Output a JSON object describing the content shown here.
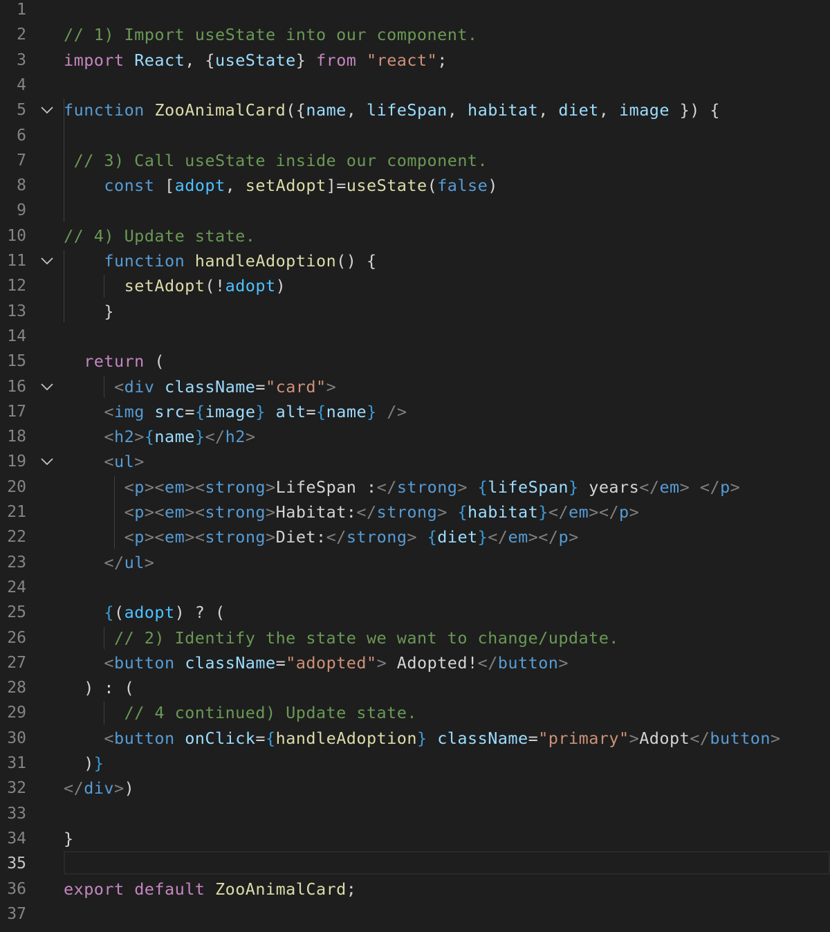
{
  "editor": {
    "current_line": 35,
    "fold_lines": [
      5,
      11,
      16,
      19
    ],
    "colors": {
      "background": "#1e1e1e",
      "comment": "#6a9955",
      "keyword": "#c586c0",
      "declaration": "#569cd6",
      "function": "#dcdcaa",
      "variable": "#9cdcfe",
      "constant": "#4fc1ff",
      "string": "#ce9178",
      "text": "#d4d4d4",
      "line_number": "#858585"
    },
    "lines": [
      {
        "n": "1",
        "indent": 0,
        "tokens": []
      },
      {
        "n": "2",
        "indent": 0,
        "tokens": [
          {
            "t": "// 1) Import useState into our component.",
            "c": "comment"
          }
        ]
      },
      {
        "n": "3",
        "indent": 0,
        "tokens": [
          {
            "t": "import",
            "c": "kw"
          },
          {
            "t": " ",
            "c": "text"
          },
          {
            "t": "React",
            "c": "var"
          },
          {
            "t": ", {",
            "c": "text"
          },
          {
            "t": "useState",
            "c": "var"
          },
          {
            "t": "} ",
            "c": "text"
          },
          {
            "t": "from",
            "c": "kw"
          },
          {
            "t": " ",
            "c": "text"
          },
          {
            "t": "\"react\"",
            "c": "str"
          },
          {
            "t": ";",
            "c": "text"
          }
        ]
      },
      {
        "n": "4",
        "indent": 0,
        "tokens": []
      },
      {
        "n": "5",
        "indent": 0,
        "tokens": [
          {
            "t": "function",
            "c": "decl"
          },
          {
            "t": " ",
            "c": "text"
          },
          {
            "t": "ZooAnimalCard",
            "c": "fn"
          },
          {
            "t": "({",
            "c": "text"
          },
          {
            "t": "name",
            "c": "var"
          },
          {
            "t": ", ",
            "c": "text"
          },
          {
            "t": "lifeSpan",
            "c": "var"
          },
          {
            "t": ", ",
            "c": "text"
          },
          {
            "t": "habitat",
            "c": "var"
          },
          {
            "t": ", ",
            "c": "text"
          },
          {
            "t": "diet",
            "c": "var"
          },
          {
            "t": ", ",
            "c": "text"
          },
          {
            "t": "image",
            "c": "var"
          },
          {
            "t": " }) {",
            "c": "text"
          }
        ]
      },
      {
        "n": "6",
        "indent": 0,
        "tokens": []
      },
      {
        "n": "7",
        "indent": 1,
        "tokens": [
          {
            "t": "// 3) Call useState inside our component.",
            "c": "comment"
          }
        ]
      },
      {
        "n": "8",
        "indent": 4,
        "tokens": [
          {
            "t": "const",
            "c": "decl"
          },
          {
            "t": " [",
            "c": "text"
          },
          {
            "t": "adopt",
            "c": "const"
          },
          {
            "t": ", ",
            "c": "text"
          },
          {
            "t": "setAdopt",
            "c": "fn"
          },
          {
            "t": "]=",
            "c": "text"
          },
          {
            "t": "useState",
            "c": "fn"
          },
          {
            "t": "(",
            "c": "text"
          },
          {
            "t": "false",
            "c": "decl"
          },
          {
            "t": ")",
            "c": "text"
          }
        ]
      },
      {
        "n": "9",
        "indent": 0,
        "tokens": []
      },
      {
        "n": "10",
        "indent": 0,
        "tokens": [
          {
            "t": "// 4) Update state.",
            "c": "comment"
          }
        ]
      },
      {
        "n": "11",
        "indent": 4,
        "tokens": [
          {
            "t": "function",
            "c": "decl"
          },
          {
            "t": " ",
            "c": "text"
          },
          {
            "t": "handleAdoption",
            "c": "fn"
          },
          {
            "t": "() {",
            "c": "text"
          }
        ]
      },
      {
        "n": "12",
        "indent": 6,
        "tokens": [
          {
            "t": "setAdopt",
            "c": "fn"
          },
          {
            "t": "(!",
            "c": "text"
          },
          {
            "t": "adopt",
            "c": "const"
          },
          {
            "t": ")",
            "c": "text"
          }
        ]
      },
      {
        "n": "13",
        "indent": 4,
        "tokens": [
          {
            "t": "}",
            "c": "text"
          }
        ]
      },
      {
        "n": "14",
        "indent": 0,
        "tokens": []
      },
      {
        "n": "15",
        "indent": 2,
        "tokens": [
          {
            "t": "return",
            "c": "kw"
          },
          {
            "t": " (",
            "c": "text"
          }
        ]
      },
      {
        "n": "16",
        "indent": 5,
        "tokens": [
          {
            "t": "<",
            "c": "bracket"
          },
          {
            "t": "div",
            "c": "tag"
          },
          {
            "t": " ",
            "c": "text"
          },
          {
            "t": "className",
            "c": "var"
          },
          {
            "t": "=",
            "c": "text"
          },
          {
            "t": "\"card\"",
            "c": "str"
          },
          {
            "t": ">",
            "c": "bracket"
          }
        ]
      },
      {
        "n": "17",
        "indent": 4,
        "tokens": [
          {
            "t": "<",
            "c": "bracket"
          },
          {
            "t": "img",
            "c": "tag"
          },
          {
            "t": " ",
            "c": "text"
          },
          {
            "t": "src",
            "c": "var"
          },
          {
            "t": "=",
            "c": "text"
          },
          {
            "t": "{",
            "c": "brace"
          },
          {
            "t": "image",
            "c": "var"
          },
          {
            "t": "}",
            "c": "brace"
          },
          {
            "t": " ",
            "c": "text"
          },
          {
            "t": "alt",
            "c": "var"
          },
          {
            "t": "=",
            "c": "text"
          },
          {
            "t": "{",
            "c": "brace"
          },
          {
            "t": "name",
            "c": "var"
          },
          {
            "t": "}",
            "c": "brace"
          },
          {
            "t": " />",
            "c": "bracket"
          }
        ]
      },
      {
        "n": "18",
        "indent": 4,
        "tokens": [
          {
            "t": "<",
            "c": "bracket"
          },
          {
            "t": "h2",
            "c": "tag"
          },
          {
            "t": ">",
            "c": "bracket"
          },
          {
            "t": "{",
            "c": "brace"
          },
          {
            "t": "name",
            "c": "var"
          },
          {
            "t": "}",
            "c": "brace"
          },
          {
            "t": "</",
            "c": "bracket"
          },
          {
            "t": "h2",
            "c": "tag"
          },
          {
            "t": ">",
            "c": "bracket"
          }
        ]
      },
      {
        "n": "19",
        "indent": 4,
        "tokens": [
          {
            "t": "<",
            "c": "bracket"
          },
          {
            "t": "ul",
            "c": "tag"
          },
          {
            "t": ">",
            "c": "bracket"
          }
        ]
      },
      {
        "n": "20",
        "indent": 6,
        "tokens": [
          {
            "t": "<",
            "c": "bracket"
          },
          {
            "t": "p",
            "c": "tag"
          },
          {
            "t": "><",
            "c": "bracket"
          },
          {
            "t": "em",
            "c": "tag"
          },
          {
            "t": "><",
            "c": "bracket"
          },
          {
            "t": "strong",
            "c": "tag"
          },
          {
            "t": ">",
            "c": "bracket"
          },
          {
            "t": "LifeSpan :",
            "c": "text"
          },
          {
            "t": "</",
            "c": "bracket"
          },
          {
            "t": "strong",
            "c": "tag"
          },
          {
            "t": ">",
            "c": "bracket"
          },
          {
            "t": " ",
            "c": "text"
          },
          {
            "t": "{",
            "c": "brace"
          },
          {
            "t": "lifeSpan",
            "c": "var"
          },
          {
            "t": "}",
            "c": "brace"
          },
          {
            "t": " years",
            "c": "text"
          },
          {
            "t": "</",
            "c": "bracket"
          },
          {
            "t": "em",
            "c": "tag"
          },
          {
            "t": ">",
            "c": "bracket"
          },
          {
            "t": " ",
            "c": "text"
          },
          {
            "t": "</",
            "c": "bracket"
          },
          {
            "t": "p",
            "c": "tag"
          },
          {
            "t": ">",
            "c": "bracket"
          }
        ]
      },
      {
        "n": "21",
        "indent": 6,
        "tokens": [
          {
            "t": "<",
            "c": "bracket"
          },
          {
            "t": "p",
            "c": "tag"
          },
          {
            "t": "><",
            "c": "bracket"
          },
          {
            "t": "em",
            "c": "tag"
          },
          {
            "t": "><",
            "c": "bracket"
          },
          {
            "t": "strong",
            "c": "tag"
          },
          {
            "t": ">",
            "c": "bracket"
          },
          {
            "t": "Habitat:",
            "c": "text"
          },
          {
            "t": "</",
            "c": "bracket"
          },
          {
            "t": "strong",
            "c": "tag"
          },
          {
            "t": ">",
            "c": "bracket"
          },
          {
            "t": " ",
            "c": "text"
          },
          {
            "t": "{",
            "c": "brace"
          },
          {
            "t": "habitat",
            "c": "var"
          },
          {
            "t": "}",
            "c": "brace"
          },
          {
            "t": "</",
            "c": "bracket"
          },
          {
            "t": "em",
            "c": "tag"
          },
          {
            "t": "></",
            "c": "bracket"
          },
          {
            "t": "p",
            "c": "tag"
          },
          {
            "t": ">",
            "c": "bracket"
          }
        ]
      },
      {
        "n": "22",
        "indent": 6,
        "tokens": [
          {
            "t": "<",
            "c": "bracket"
          },
          {
            "t": "p",
            "c": "tag"
          },
          {
            "t": "><",
            "c": "bracket"
          },
          {
            "t": "em",
            "c": "tag"
          },
          {
            "t": "><",
            "c": "bracket"
          },
          {
            "t": "strong",
            "c": "tag"
          },
          {
            "t": ">",
            "c": "bracket"
          },
          {
            "t": "Diet:",
            "c": "text"
          },
          {
            "t": "</",
            "c": "bracket"
          },
          {
            "t": "strong",
            "c": "tag"
          },
          {
            "t": ">",
            "c": "bracket"
          },
          {
            "t": " ",
            "c": "text"
          },
          {
            "t": "{",
            "c": "brace"
          },
          {
            "t": "diet",
            "c": "var"
          },
          {
            "t": "}",
            "c": "brace"
          },
          {
            "t": "</",
            "c": "bracket"
          },
          {
            "t": "em",
            "c": "tag"
          },
          {
            "t": "></",
            "c": "bracket"
          },
          {
            "t": "p",
            "c": "tag"
          },
          {
            "t": ">",
            "c": "bracket"
          }
        ]
      },
      {
        "n": "23",
        "indent": 4,
        "tokens": [
          {
            "t": "</",
            "c": "bracket"
          },
          {
            "t": "ul",
            "c": "tag"
          },
          {
            "t": ">",
            "c": "bracket"
          }
        ]
      },
      {
        "n": "24",
        "indent": 0,
        "tokens": []
      },
      {
        "n": "25",
        "indent": 4,
        "tokens": [
          {
            "t": "{",
            "c": "brace"
          },
          {
            "t": "(",
            "c": "text"
          },
          {
            "t": "adopt",
            "c": "const"
          },
          {
            "t": ") ? (",
            "c": "text"
          }
        ]
      },
      {
        "n": "26",
        "indent": 5,
        "tokens": [
          {
            "t": "// 2) Identify the state we want to change/update.",
            "c": "comment"
          }
        ]
      },
      {
        "n": "27",
        "indent": 4,
        "tokens": [
          {
            "t": "<",
            "c": "bracket"
          },
          {
            "t": "button",
            "c": "tag"
          },
          {
            "t": " ",
            "c": "text"
          },
          {
            "t": "className",
            "c": "var"
          },
          {
            "t": "=",
            "c": "text"
          },
          {
            "t": "\"adopted\"",
            "c": "str"
          },
          {
            "t": ">",
            "c": "bracket"
          },
          {
            "t": " Adopted!",
            "c": "text"
          },
          {
            "t": "</",
            "c": "bracket"
          },
          {
            "t": "button",
            "c": "tag"
          },
          {
            "t": ">",
            "c": "bracket"
          }
        ]
      },
      {
        "n": "28",
        "indent": 2,
        "tokens": [
          {
            "t": ") : (",
            "c": "text"
          }
        ]
      },
      {
        "n": "29",
        "indent": 6,
        "tokens": [
          {
            "t": "// 4 continued) Update state.",
            "c": "comment"
          }
        ]
      },
      {
        "n": "30",
        "indent": 4,
        "tokens": [
          {
            "t": "<",
            "c": "bracket"
          },
          {
            "t": "button",
            "c": "tag"
          },
          {
            "t": " ",
            "c": "text"
          },
          {
            "t": "onClick",
            "c": "var"
          },
          {
            "t": "=",
            "c": "text"
          },
          {
            "t": "{",
            "c": "brace"
          },
          {
            "t": "handleAdoption",
            "c": "fn"
          },
          {
            "t": "}",
            "c": "brace"
          },
          {
            "t": " ",
            "c": "text"
          },
          {
            "t": "className",
            "c": "var"
          },
          {
            "t": "=",
            "c": "text"
          },
          {
            "t": "\"primary\"",
            "c": "str"
          },
          {
            "t": ">",
            "c": "bracket"
          },
          {
            "t": "Adopt",
            "c": "text"
          },
          {
            "t": "</",
            "c": "bracket"
          },
          {
            "t": "button",
            "c": "tag"
          },
          {
            "t": ">",
            "c": "bracket"
          }
        ]
      },
      {
        "n": "31",
        "indent": 2,
        "tokens": [
          {
            "t": ")",
            "c": "text"
          },
          {
            "t": "}",
            "c": "brace"
          }
        ]
      },
      {
        "n": "32",
        "indent": 0,
        "tokens": [
          {
            "t": "</",
            "c": "bracket"
          },
          {
            "t": "div",
            "c": "tag"
          },
          {
            "t": ">",
            "c": "bracket"
          },
          {
            "t": ")",
            "c": "text"
          }
        ]
      },
      {
        "n": "33",
        "indent": 0,
        "tokens": []
      },
      {
        "n": "34",
        "indent": 0,
        "tokens": [
          {
            "t": "}",
            "c": "text"
          }
        ]
      },
      {
        "n": "35",
        "indent": 0,
        "tokens": []
      },
      {
        "n": "36",
        "indent": 0,
        "tokens": [
          {
            "t": "export",
            "c": "kw"
          },
          {
            "t": " ",
            "c": "text"
          },
          {
            "t": "default",
            "c": "kw"
          },
          {
            "t": " ",
            "c": "text"
          },
          {
            "t": "ZooAnimalCard",
            "c": "fn"
          },
          {
            "t": ";",
            "c": "text"
          }
        ]
      },
      {
        "n": "37",
        "indent": 0,
        "tokens": []
      }
    ]
  }
}
